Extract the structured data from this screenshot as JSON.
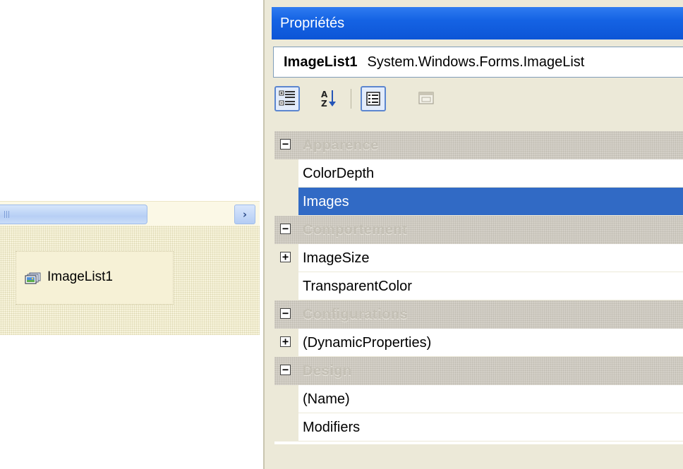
{
  "designer": {
    "tray_item_label": "ImageList1",
    "tray_item_icon": "imagelist-icon",
    "scroll_right_glyph": "›"
  },
  "properties": {
    "title": "Propriétés",
    "object_name": "ImageList1",
    "object_type": "System.Windows.Forms.ImageList",
    "toolbar": {
      "categorized_icon": "categorized-icon",
      "alphabetical_icon": "alphabetical-icon",
      "properties_icon": "properties-icon",
      "property_pages_icon": "property-pages-icon"
    },
    "rows": [
      {
        "kind": "category",
        "toggle": "−",
        "label": "Apparence"
      },
      {
        "kind": "property",
        "toggle": "",
        "label": "ColorDepth"
      },
      {
        "kind": "property",
        "toggle": "",
        "label": "Images",
        "selected": true
      },
      {
        "kind": "category",
        "toggle": "−",
        "label": "Comportement"
      },
      {
        "kind": "property",
        "toggle": "+",
        "label": "ImageSize"
      },
      {
        "kind": "property",
        "toggle": "",
        "label": "TransparentColor"
      },
      {
        "kind": "category",
        "toggle": "−",
        "label": "Configurations"
      },
      {
        "kind": "property",
        "toggle": "+",
        "label": "(DynamicProperties)"
      },
      {
        "kind": "category",
        "toggle": "−",
        "label": "Design"
      },
      {
        "kind": "property",
        "toggle": "",
        "label": "(Name)"
      },
      {
        "kind": "property",
        "toggle": "",
        "label": "Modifiers"
      }
    ]
  },
  "colors": {
    "title_bar": "#1563e4",
    "selection": "#316ac5",
    "panel_bg": "#ece9d8",
    "tray_bg": "#f8f4dc"
  }
}
